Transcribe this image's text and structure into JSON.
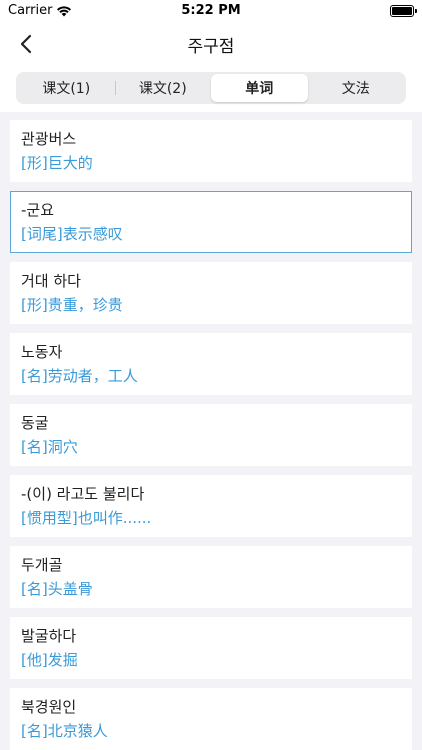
{
  "status": {
    "carrier": "Carrier",
    "time": "5:22 PM"
  },
  "nav": {
    "title": "주구점"
  },
  "tabs": [
    {
      "label": "课文(1)",
      "active": false
    },
    {
      "label": "课文(2)",
      "active": false
    },
    {
      "label": "单词",
      "active": true
    },
    {
      "label": "文法",
      "active": false
    }
  ],
  "words": [
    {
      "word": "관광버스",
      "meaning": "[形]巨大的"
    },
    {
      "word": "-군요",
      "meaning": "[词尾]表示感叹"
    },
    {
      "word": "거대 하다",
      "meaning": "[形]贵重，珍贵"
    },
    {
      "word": "노동자",
      "meaning": "[名]劳动者，工人"
    },
    {
      "word": "동굴",
      "meaning": "[名]洞穴"
    },
    {
      "word": "-(이) 라고도 불리다",
      "meaning": "[惯用型]也叫作......"
    },
    {
      "word": " 두개골",
      "meaning": "[名]头盖骨"
    },
    {
      "word": " 발굴하다",
      "meaning": "[他]发掘"
    },
    {
      "word": "북경원인",
      "meaning": "[名]北京猿人"
    }
  ],
  "colors": {
    "accent": "#3a9ad9",
    "selected_border": "#5aa8d8",
    "background": "#f2f2f7"
  },
  "selected_index": 1
}
